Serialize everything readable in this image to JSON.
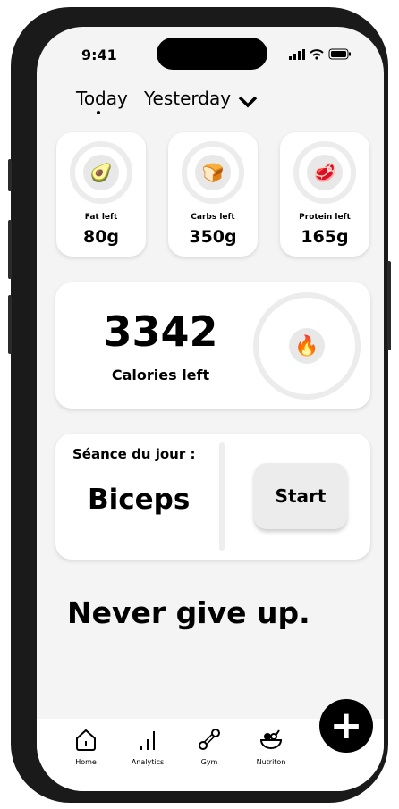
{
  "status": {
    "time": "9:41"
  },
  "header": {
    "tabs": [
      {
        "label": "Today",
        "active": true
      },
      {
        "label": "Yesterday",
        "active": false
      }
    ]
  },
  "macros": [
    {
      "label": "Fat left",
      "value": "80g",
      "icon": "avocado-icon",
      "emoji": "🥑"
    },
    {
      "label": "Carbs left",
      "value": "350g",
      "icon": "bread-icon",
      "emoji": "🍞"
    },
    {
      "label": "Protein left",
      "value": "165g",
      "icon": "meat-icon",
      "emoji": "🥩"
    }
  ],
  "calories": {
    "value": "3342",
    "label": "Calories left",
    "emoji": "🔥"
  },
  "session": {
    "title": "Séance du jour :",
    "name": "Biceps",
    "start_label": "Start"
  },
  "motto": "Never give up.",
  "nav": [
    {
      "label": "Home"
    },
    {
      "label": "Analytics"
    },
    {
      "label": "Gym"
    },
    {
      "label": "Nutriton"
    }
  ],
  "fab": "+"
}
